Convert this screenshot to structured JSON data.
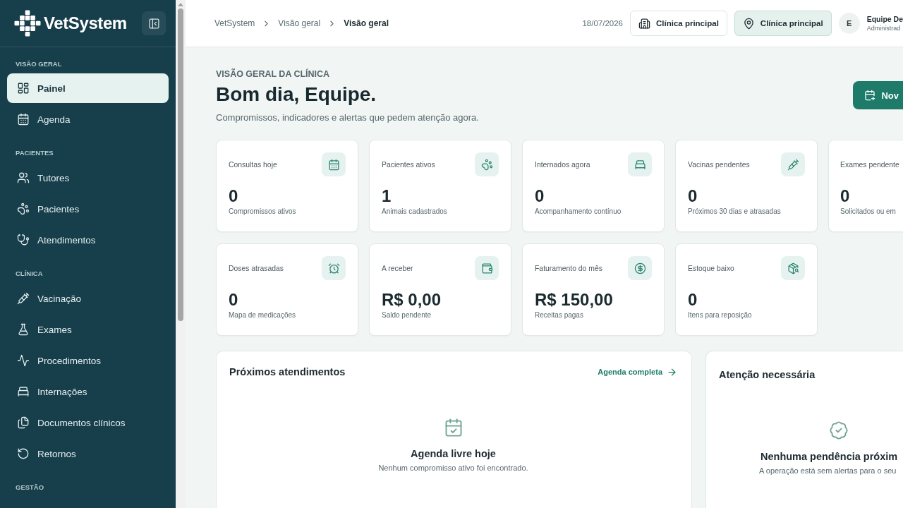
{
  "sidebar": {
    "brand": "VetSystem",
    "sections": [
      {
        "title": "VISÃO GERAL",
        "items": [
          {
            "label": "Painel",
            "selected": true
          },
          {
            "label": "Agenda",
            "selected": false
          }
        ]
      },
      {
        "title": "PACIENTES",
        "items": [
          {
            "label": "Tutores",
            "selected": false
          },
          {
            "label": "Pacientes",
            "selected": false
          },
          {
            "label": "Atendimentos",
            "selected": false
          }
        ]
      },
      {
        "title": "CLÍNICA",
        "items": [
          {
            "label": "Vacinação",
            "selected": false
          },
          {
            "label": "Exames",
            "selected": false
          },
          {
            "label": "Procedimentos",
            "selected": false
          },
          {
            "label": "Internações",
            "selected": false
          },
          {
            "label": "Documentos clínicos",
            "selected": false
          },
          {
            "label": "Retornos",
            "selected": false
          }
        ]
      },
      {
        "title": "GESTÃO"
      }
    ]
  },
  "header": {
    "breadcrumb": [
      {
        "label": "VetSystem",
        "current": false
      },
      {
        "label": "Visão geral",
        "current": false
      },
      {
        "label": "Visão geral",
        "current": true
      }
    ],
    "date": "18/07/2026",
    "buttons": [
      {
        "kind": "outline",
        "label": "Clínica principal"
      },
      {
        "kind": "tinted",
        "label": "Clínica principal"
      }
    ],
    "user": {
      "initial": "E",
      "name": "Equipe De",
      "role": "Administrad"
    }
  },
  "page": {
    "eyebrow": "VISÃO GERAL DA CLÍNICA",
    "title": "Bom dia, Equipe.",
    "subtitle": "Compromissos, indicadores e alertas que pedem atenção agora.",
    "action": "Nov"
  },
  "stats": [
    {
      "label": "Consultas hoje",
      "value": "0",
      "note": "Compromissos ativos"
    },
    {
      "label": "Pacientes ativos",
      "value": "1",
      "note": "Animais cadastrados"
    },
    {
      "label": "Internados agora",
      "value": "0",
      "note": "Acompanhamento contínuo"
    },
    {
      "label": "Vacinas pendentes",
      "value": "0",
      "note": "Próximos 30 dias e atrasadas"
    },
    {
      "label": "Exames pendente",
      "value": "0",
      "note": "Solicitados ou em"
    },
    {
      "label": "Doses atrasadas",
      "value": "0",
      "note": "Mapa de medicações"
    },
    {
      "label": "A receber",
      "value": "R$ 0,00",
      "note": "Saldo pendente"
    },
    {
      "label": "Faturamento do mês",
      "value": "R$ 150,00",
      "note": "Receitas pagas"
    },
    {
      "label": "Estoque baixo",
      "value": "0",
      "note": "Itens para reposição"
    }
  ],
  "panels": [
    {
      "title": "Próximos atendimentos",
      "link": "Agenda completa",
      "empty_title": "Agenda livre hoje",
      "empty_text": "Nenhum compromisso ativo foi encontrado."
    },
    {
      "title": "Atenção necessária",
      "empty_title": "Nenhuma pendência próxim",
      "empty_text": "A operação está sem alertas para o seu"
    }
  ]
}
